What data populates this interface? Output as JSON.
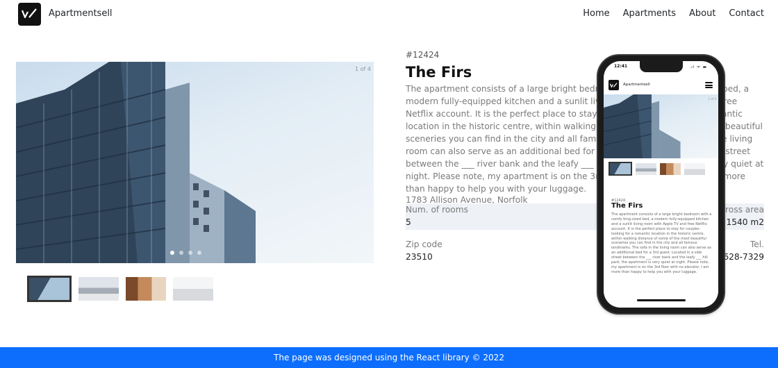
{
  "header": {
    "brand": "Apartmentsell",
    "nav": [
      "Home",
      "Apartments",
      "About",
      "Contact"
    ]
  },
  "gallery": {
    "counter": "1 of 4",
    "slide_count": 4,
    "active_index": 0
  },
  "apartment": {
    "id": "#12424",
    "title": "The Firs",
    "description": "The apartment consists of a large bright bedroom with a comfy king-sized bed, a modern fully-equipped kitchen and a sunlit living room with Apple TV and free Netflix account. It is the perfect place to stay for couples looking for a romantic location in the historic centre, within walking distance of some of the most beautiful sceneries you can find in the city and all famous landmarks. The sofa in the living room can also serve as an additional bed for a 3rd guest. Located in a side street between the ___ river bank and the leafy ___ hill park, the apartment is very quiet at night. Please note, my apartment is on the 3rd floor with no elevator. I am more than happy to help you with your luggage.",
    "address": "1783 Allison Avenue, Norfolk",
    "specs": [
      {
        "label": "Num. of rooms",
        "value": "5",
        "label_right": "Gross area",
        "value_right": "1540 m2"
      },
      {
        "label": "Zip code",
        "value": "23510",
        "label_right": "Tel.",
        "value_right": "757-628-7329"
      }
    ]
  },
  "phone": {
    "time": "12:41",
    "status_icons": ".ıl ᯤ ▬",
    "brand": "Apartmentsell",
    "counter": "1 of 4",
    "id": "#12424",
    "title": "The Firs",
    "description": "The apartment consists of a large bright bedroom with a comfy king-sized bed, a modern fully-equipped kitchen and a sunlit living room with Apple TV and free Netflix account. It is the perfect place to stay for couples looking for a romantic location in the historic centre, within walking distance of some of the most beautiful sceneries you can find in the city and all famous landmarks. The sofa in the living room can also serve as an additional bed for a 3rd guest. Located in a side street between the ___ river bank and the leafy ___ hill park, the apartment is very quiet at night. Please note, my apartment is on the 3rd floor with no elevator. I am more than happy to help you with your luggage."
  },
  "footer": {
    "text": "The page was designed using the React library © 2022"
  },
  "colors": {
    "accent": "#0d6efd",
    "spec_row_bg": "#eef1f6"
  }
}
